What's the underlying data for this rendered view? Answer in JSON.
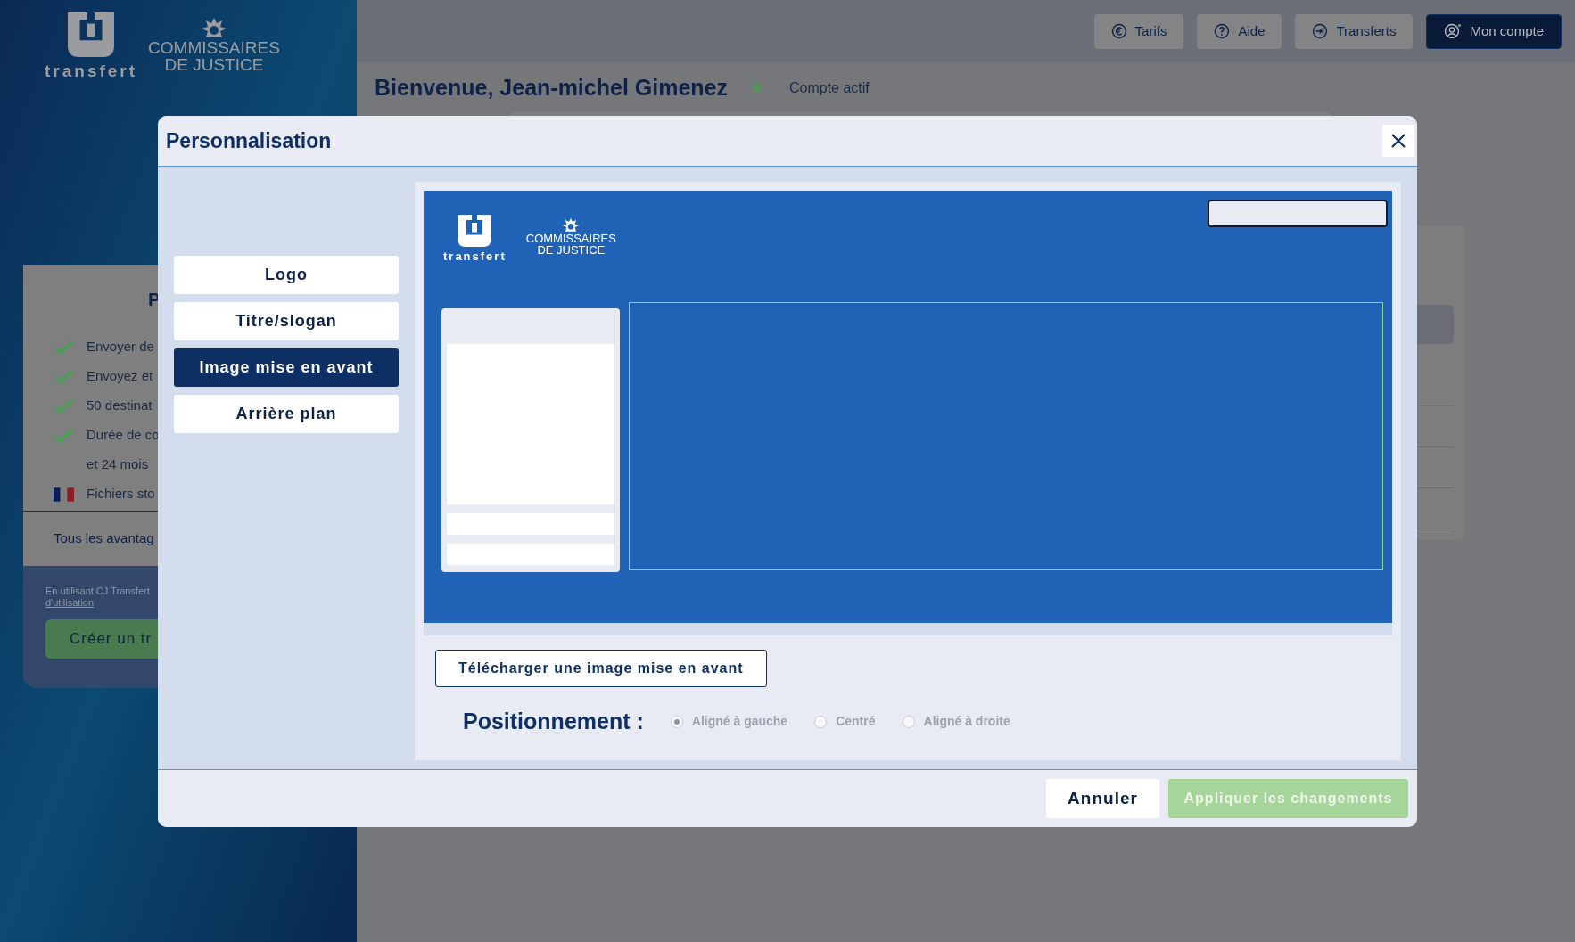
{
  "sidebar": {
    "brand": "transfert",
    "org_lines": [
      "COMMISSAIRES",
      "DE JUSTICE"
    ]
  },
  "top_nav": [
    {
      "label": "Tarifs",
      "kind": "euro",
      "primary": false
    },
    {
      "label": "Aide",
      "kind": "help",
      "primary": false
    },
    {
      "label": "Transferts",
      "kind": "transfer",
      "primary": false
    },
    {
      "label": "Mon compte",
      "kind": "account",
      "primary": true
    }
  ],
  "welcome": {
    "title": "Bienvenue, Jean-michel Gimenez",
    "status": "Compte actif"
  },
  "offer_card": {
    "heading": "P",
    "features": [
      {
        "text": "Envoyer de",
        "kind": "check"
      },
      {
        "text": "Envoyez et",
        "kind": "check"
      },
      {
        "text": "50 destinat",
        "kind": "check"
      },
      {
        "text": "Durée de co",
        "kind": "check"
      },
      {
        "text": "et 24 mois",
        "kind": "plain"
      },
      {
        "text": "Fichiers sto",
        "kind": "flag"
      }
    ],
    "link": "Tous les avantag",
    "notice": "En utilisant CJ Transfert",
    "notice_link": "d'utilisation",
    "button": "Créer un tr"
  },
  "modal": {
    "title": "Personnalisation",
    "tabs": [
      {
        "label": "Logo",
        "selected": false
      },
      {
        "label": "Titre/slogan",
        "selected": false
      },
      {
        "label": "Image mise en avant",
        "selected": true
      },
      {
        "label": "Arrière plan",
        "selected": false
      }
    ],
    "preview": {
      "brand": "transfert",
      "org_lines": [
        "COMMISSAIRES",
        "DE JUSTICE"
      ]
    },
    "upload_button": "Télécharger une image mise en avant",
    "positioning": {
      "label": "Positionnement :",
      "options": [
        {
          "label": "Aligné à gauche",
          "selected": true,
          "disabled": true
        },
        {
          "label": "Centré",
          "selected": false,
          "disabled": true
        },
        {
          "label": "Aligné à droite",
          "selected": false,
          "disabled": true
        }
      ]
    },
    "cancel": "Annuler",
    "apply": {
      "label": "Appliquer les changements",
      "disabled": true
    }
  }
}
